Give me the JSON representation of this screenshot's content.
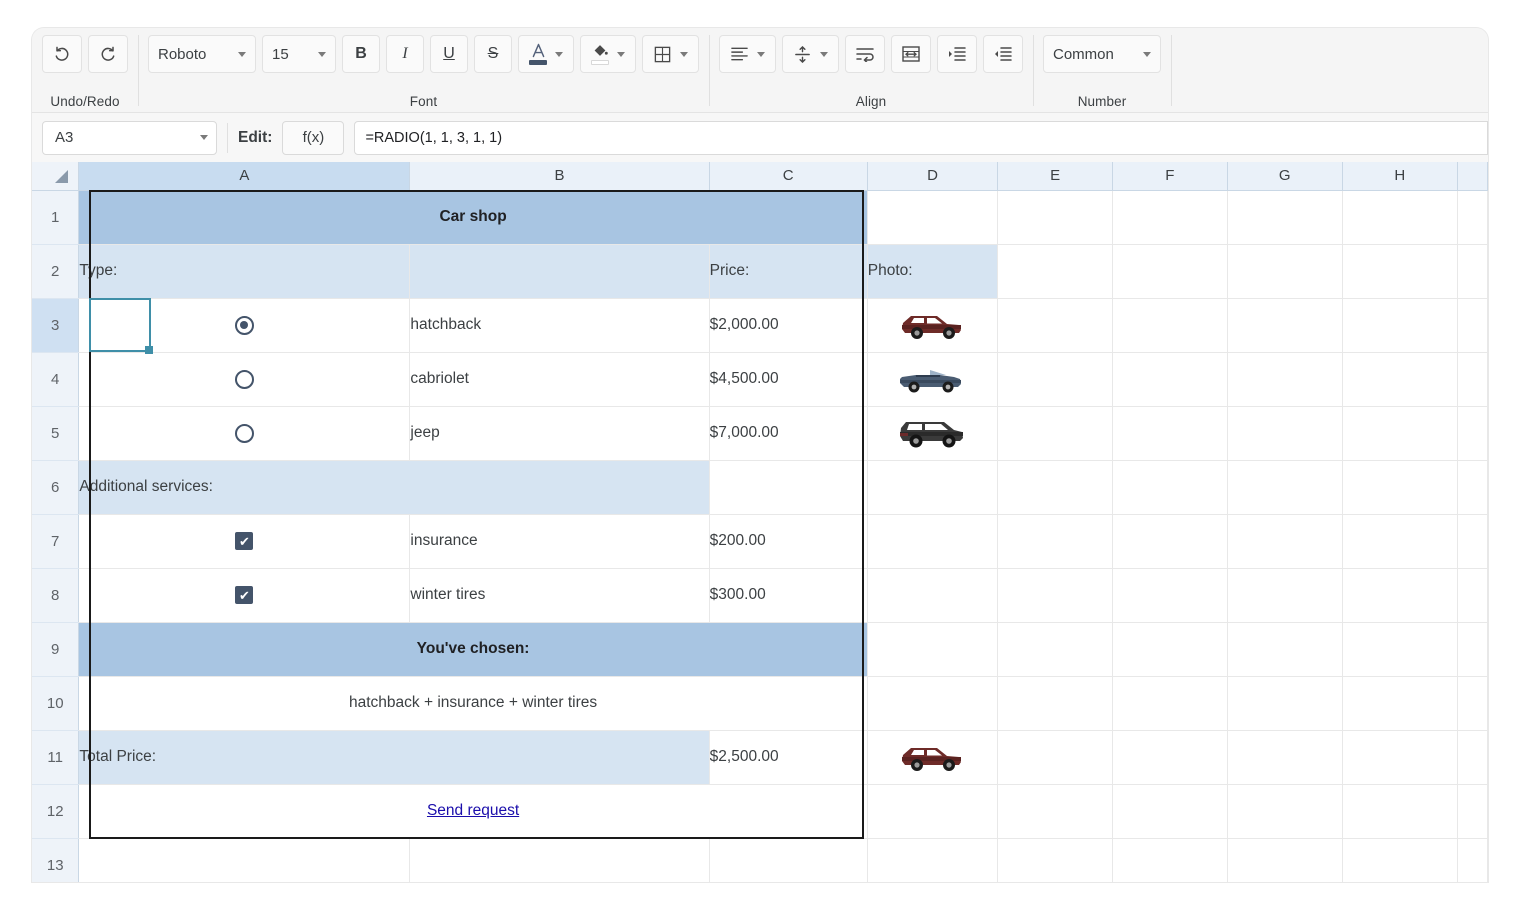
{
  "ribbon": {
    "groups": [
      {
        "name": "undo-redo",
        "label": "Undo/Redo",
        "buttons": [
          {
            "name": "undo-button",
            "icon": "undo-icon",
            "label": "↶"
          },
          {
            "name": "redo-button",
            "icon": "redo-icon",
            "label": "↷"
          }
        ]
      },
      {
        "name": "font",
        "label": "Font",
        "font_family": "Roboto",
        "font_size": "15",
        "buttons": [
          {
            "name": "bold-button",
            "label": "B"
          },
          {
            "name": "italic-button",
            "label": "I"
          },
          {
            "name": "underline-button",
            "label": "U"
          },
          {
            "name": "strikethrough-button",
            "label": "S"
          },
          {
            "name": "text-color-button",
            "label": "A"
          },
          {
            "name": "fill-color-button",
            "label": "◆"
          },
          {
            "name": "borders-button",
            "label": "⊞"
          }
        ]
      },
      {
        "name": "align",
        "label": "Align",
        "buttons": [
          {
            "name": "horizontal-align-button",
            "label": "≡"
          },
          {
            "name": "vertical-align-button",
            "label": "↕"
          },
          {
            "name": "wrap-text-button",
            "label": "↵"
          },
          {
            "name": "merge-cells-button",
            "label": "↔"
          },
          {
            "name": "increase-indent-button",
            "label": "→"
          },
          {
            "name": "decrease-indent-button",
            "label": "←"
          }
        ]
      },
      {
        "name": "number",
        "label": "Number",
        "format": "Common"
      }
    ]
  },
  "formula_bar": {
    "cell_reference": "A3",
    "edit_label": "Edit:",
    "function_button": "f(x)",
    "formula": "=RADIO(1, 1, 3, 1, 1)"
  },
  "grid": {
    "columns": [
      "A",
      "B",
      "C",
      "D",
      "E",
      "F",
      "G",
      "H"
    ],
    "selected_column": "A",
    "selected_row": 3,
    "rows": [
      {
        "number": "1",
        "type": "title",
        "text": "Car shop"
      },
      {
        "number": "2",
        "type": "header",
        "a": "Type:",
        "c": "Price:",
        "d": "Photo:"
      },
      {
        "number": "3",
        "type": "option",
        "control": "radio",
        "checked": true,
        "label": "hatchback",
        "price": "$2,000.00",
        "photo": "car-hatchback-red"
      },
      {
        "number": "4",
        "type": "option",
        "control": "radio",
        "checked": false,
        "label": "cabriolet",
        "price": "$4,500.00",
        "photo": "car-cabriolet-blue"
      },
      {
        "number": "5",
        "type": "option",
        "control": "radio",
        "checked": false,
        "label": "jeep",
        "price": "$7,000.00",
        "photo": "car-jeep-black"
      },
      {
        "number": "6",
        "type": "section",
        "text": "Additional services:"
      },
      {
        "number": "7",
        "type": "option",
        "control": "checkbox",
        "checked": true,
        "label": "insurance",
        "price": "$200.00",
        "photo": ""
      },
      {
        "number": "8",
        "type": "option",
        "control": "checkbox",
        "checked": true,
        "label": "winter tires",
        "price": "$300.00",
        "photo": ""
      },
      {
        "number": "9",
        "type": "title",
        "text": "You've chosen:"
      },
      {
        "number": "10",
        "type": "summary",
        "text": "hatchback + insurance + winter tires"
      },
      {
        "number": "11",
        "type": "total",
        "label": "Total Price:",
        "price": "$2,500.00",
        "photo": "car-hatchback-red"
      },
      {
        "number": "12",
        "type": "link",
        "text": "Send request"
      },
      {
        "number": "13",
        "type": "empty"
      }
    ]
  },
  "colors": {
    "title_band": "#a8c5e2",
    "subheader": "#d6e4f2",
    "selection": "#3f8fa8",
    "link": "#1a0dab",
    "control": "#44546a",
    "header_bg": "#eaf1f9"
  }
}
